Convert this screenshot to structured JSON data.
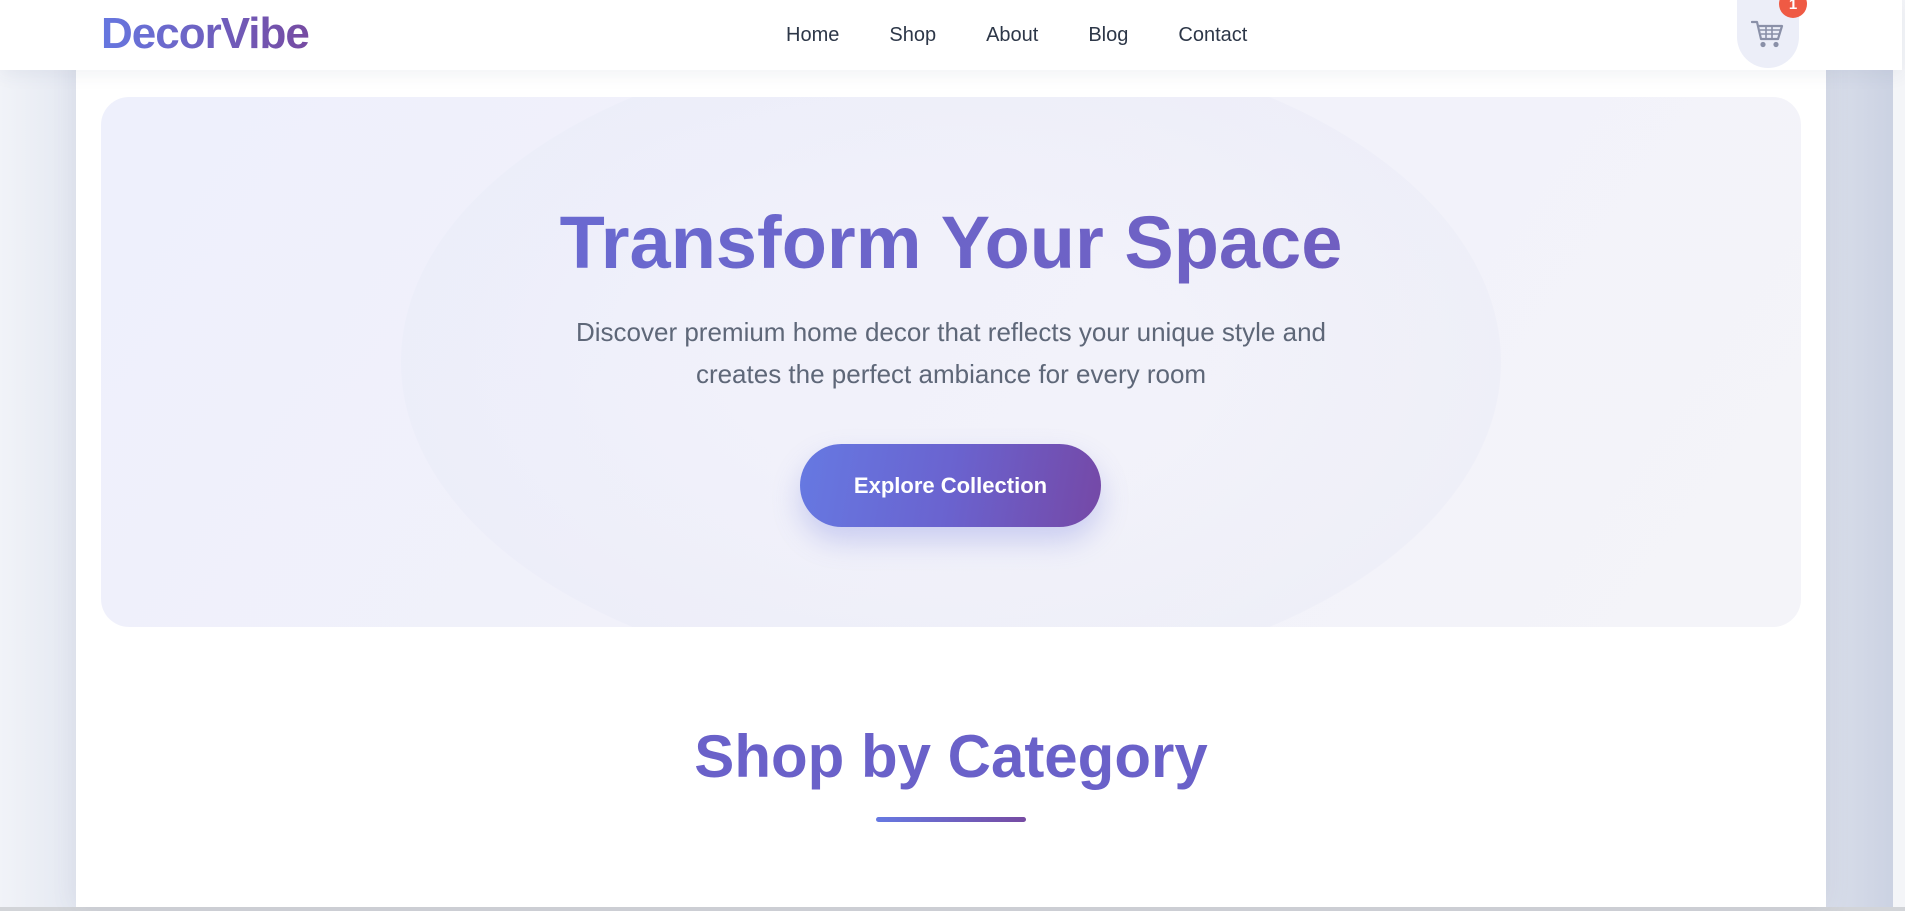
{
  "header": {
    "logo": "DecorVibe",
    "nav": [
      {
        "label": "Home"
      },
      {
        "label": "Shop"
      },
      {
        "label": "About"
      },
      {
        "label": "Blog"
      },
      {
        "label": "Contact"
      }
    ],
    "cart": {
      "icon": "cart-icon",
      "badge_count": "1"
    }
  },
  "hero": {
    "title": "Transform Your Space",
    "subtitle": "Discover premium home decor that reflects your unique style and creates the perfect ambiance for every room",
    "cta_label": "Explore Collection"
  },
  "categories": {
    "title": "Shop by Category"
  },
  "colors": {
    "brand_start": "#667eea",
    "brand_end": "#764ba2",
    "badge": "#ef5a44",
    "text_dark": "#2d3748",
    "text_muted": "#5e6778"
  }
}
